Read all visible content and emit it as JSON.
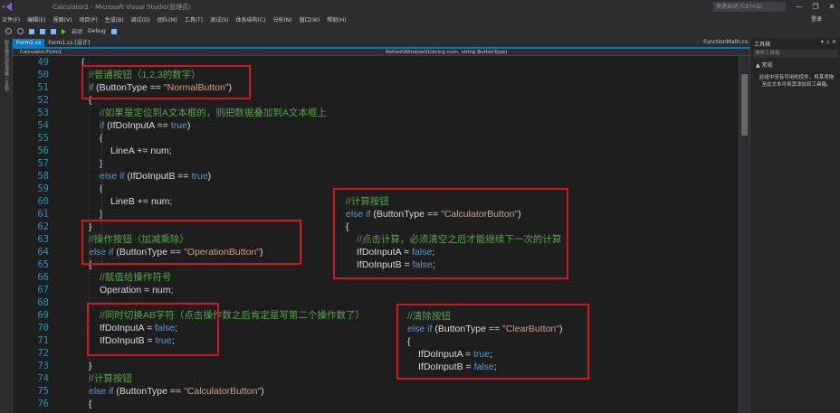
{
  "window": {
    "title": "Calculator2 - Microsoft Visual Studio(管理员)",
    "quick_launch": "快速启动 (Ctrl+Q)",
    "sign_in": "登录"
  },
  "menu": [
    "文件(F)",
    "编辑(E)",
    "视图(V)",
    "项目(P)",
    "生成(B)",
    "调试(D)",
    "团队(M)",
    "工具(T)",
    "测试(S)",
    "体系结构(C)",
    "分析(N)",
    "窗口(W)",
    "帮助(H)"
  ],
  "toolbar": {
    "start": "启动",
    "config": "Debug"
  },
  "left_rail": "服务器资源管理器 工具箱",
  "tabs": [
    {
      "label": "Form1.cs",
      "active": true
    },
    {
      "label": "Form1.cs [设计]",
      "active": false
    }
  ],
  "tab_right": "FunctionMath.cs",
  "nav": {
    "left": "Calculator.Form1",
    "right": "RefreshWindowUI(string num, string ButtonType)"
  },
  "toolbox": {
    "title": "工具箱",
    "search": "搜索工具箱",
    "group": "▲ 常规",
    "message": "此组中没有可用的控件。将某项拖至此文本可将其添加到工具箱。"
  },
  "line_numbers": [
    49,
    50,
    51,
    52,
    53,
    54,
    55,
    56,
    57,
    58,
    59,
    60,
    61,
    62,
    63,
    64,
    65,
    66,
    67,
    68,
    69,
    70,
    71,
    72,
    73,
    74,
    75,
    76
  ],
  "code_lines": [
    [
      [
        "p",
        "{"
      ]
    ],
    [
      [
        "c",
        "//普通按钮（1,2,3的数字）"
      ]
    ],
    [
      [
        "k",
        "if"
      ],
      [
        "p",
        " (ButtonType == "
      ],
      [
        "s",
        "\"NormalButton\""
      ],
      [
        "p",
        ")"
      ]
    ],
    [
      [
        "p",
        "{"
      ]
    ],
    [
      [
        "c",
        "//如果是定位到A文本框的，则把数据叠加到A文本框上"
      ]
    ],
    [
      [
        "k",
        "if"
      ],
      [
        "p",
        " (IfDoInputA == "
      ],
      [
        "k",
        "true"
      ],
      [
        "p",
        ")"
      ]
    ],
    [
      [
        "p",
        "{"
      ]
    ],
    [
      [
        "p",
        "LineA += num;"
      ]
    ],
    [
      [
        "p",
        "}"
      ]
    ],
    [
      [
        "k",
        "else if"
      ],
      [
        "p",
        " (IfDoInputB == "
      ],
      [
        "k",
        "true"
      ],
      [
        "p",
        ")"
      ]
    ],
    [
      [
        "p",
        "{"
      ]
    ],
    [
      [
        "p",
        "LineB += num;"
      ]
    ],
    [
      [
        "p",
        "}"
      ]
    ],
    [
      [
        "p",
        "}"
      ]
    ],
    [
      [
        "c",
        "//操作按钮（加减乘除）"
      ]
    ],
    [
      [
        "k",
        "else if"
      ],
      [
        "p",
        " (ButtonType == "
      ],
      [
        "s",
        "\"OperationButton\""
      ],
      [
        "p",
        ")"
      ]
    ],
    [
      [
        "p",
        "{"
      ]
    ],
    [
      [
        "c",
        "//赋值给操作符号"
      ]
    ],
    [
      [
        "p",
        "Operation = num;"
      ]
    ],
    [],
    [
      [
        "c",
        "//同时切换AB字符（点击操作数之后肯定是写第二个操作数了）"
      ]
    ],
    [
      [
        "p",
        "IfDoInputA = "
      ],
      [
        "k",
        "false"
      ],
      [
        "p",
        ";"
      ]
    ],
    [
      [
        "p",
        "IfDoInputB = "
      ],
      [
        "k",
        "true"
      ],
      [
        "p",
        ";"
      ]
    ],
    [],
    [
      [
        "p",
        "}"
      ]
    ],
    [
      [
        "c",
        "//计算按钮"
      ]
    ],
    [
      [
        "k",
        "else if"
      ],
      [
        "p",
        " (ButtonType == "
      ],
      [
        "s",
        "\"CalculatorButton\""
      ],
      [
        "p",
        ")"
      ]
    ],
    [
      [
        "p",
        "{"
      ]
    ]
  ],
  "overlay_calc": [
    [
      [
        "c",
        "//计算按钮"
      ]
    ],
    [
      [
        "k",
        "else if"
      ],
      [
        "p",
        " (ButtonType == "
      ],
      [
        "s",
        "\"CalculatorButton\""
      ],
      [
        "p",
        ")"
      ]
    ],
    [
      [
        "p",
        "{"
      ]
    ],
    [
      [
        "c",
        "//点击计算，必须清空之后才能继续下一次的计算"
      ]
    ],
    [
      [
        "p",
        "IfDoInputA = "
      ],
      [
        "k",
        "false"
      ],
      [
        "p",
        ";"
      ]
    ],
    [
      [
        "p",
        "IfDoInputB = "
      ],
      [
        "k",
        "false"
      ],
      [
        "p",
        ";"
      ]
    ]
  ],
  "overlay_clear": [
    [
      [
        "c",
        "//清除按钮"
      ]
    ],
    [
      [
        "k",
        "else if"
      ],
      [
        "p",
        " (ButtonType == "
      ],
      [
        "s",
        "\"ClearButton\""
      ],
      [
        "p",
        ")"
      ]
    ],
    [
      [
        "p",
        "{"
      ]
    ],
    [
      [
        "p",
        "IfDoInputA = "
      ],
      [
        "k",
        "true"
      ],
      [
        "p",
        ";"
      ]
    ],
    [
      [
        "p",
        "IfDoInputB = "
      ],
      [
        "k",
        "false"
      ],
      [
        "p",
        ";"
      ]
    ]
  ],
  "colors": {
    "keyword": "#569cd6",
    "string": "#d69d85",
    "comment": "#57a64a",
    "annotation": "#d0191f",
    "accent": "#007acc"
  }
}
